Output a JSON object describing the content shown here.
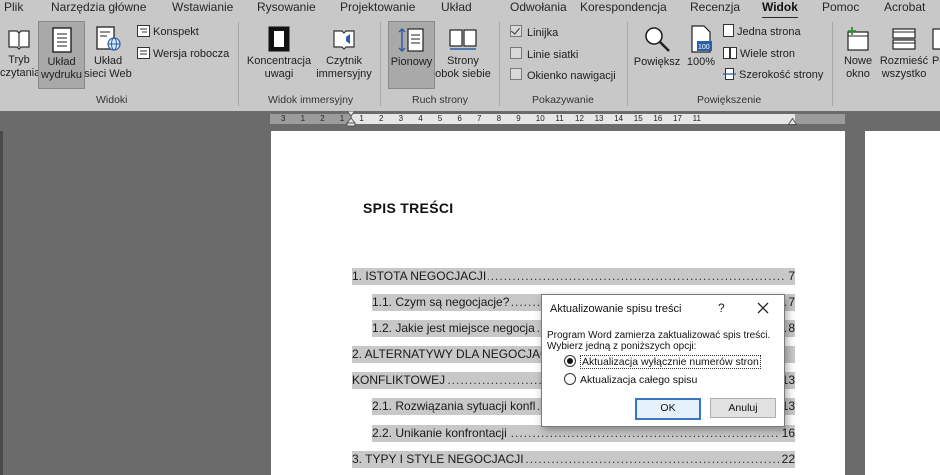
{
  "ribbon_tabs": [
    "Plik",
    "Narzędzia główne",
    "Wstawianie",
    "Rysowanie",
    "Projektowanie",
    "Układ",
    "Odwołania",
    "Korespondencja",
    "Recenzja",
    "Widok",
    "Pomoc",
    "Acrobat"
  ],
  "active_tab": "Widok",
  "groups": {
    "widoki": {
      "label": "Widoki",
      "tryb_czytania": [
        "Tryb",
        "czytania"
      ],
      "uklad_wydruku": [
        "Układ",
        "wydruku"
      ],
      "uklad_sieci_web": [
        "Układ",
        "sieci Web"
      ],
      "konspekt": "Konspekt",
      "wersja_robocza": "Wersja robocza"
    },
    "widok_immersyjny": {
      "label": "Widok immersyjny",
      "koncentracja": [
        "Koncentracja",
        "uwagi"
      ],
      "czytnik": [
        "Czytnik",
        "immersyjny"
      ]
    },
    "ruch_strony": {
      "label": "Ruch strony",
      "pionowy": "Pionowy",
      "strony_obok": [
        "Strony",
        "obok siebie"
      ]
    },
    "pokazywanie": {
      "label": "Pokazywanie",
      "linijka": "Linijka",
      "linijka_checked": true,
      "linie_siatki": "Linie siatki",
      "linie_siatki_checked": false,
      "okienko": "Okienko nawigacji",
      "okienko_checked": false
    },
    "powiekszenie": {
      "label": "Powiększenie",
      "powieksz": "Powiększ",
      "procent": "100%",
      "jedna_strona": "Jedna strona",
      "wiele_stron": "Wiele stron",
      "szerokosc": "Szerokość strony"
    },
    "okno": {
      "nowe_okno": [
        "Nowe",
        "okno"
      ],
      "rozmiesc": [
        "Rozmieść",
        "wszystko"
      ],
      "p_cut": "Po"
    }
  },
  "ruler_numbers": [
    "3",
    "1",
    "2",
    "1",
    "1",
    "2",
    "3",
    "4",
    "5",
    "6",
    "7",
    "8",
    "9",
    "10",
    "11",
    "12",
    "13",
    "14",
    "15",
    "16",
    "17",
    "11"
  ],
  "document": {
    "toc_title": "SPIS TREŚCI",
    "entries": [
      {
        "text": "1. ISTOTA NEGOCJACJI",
        "page": "7"
      },
      {
        "text": "1.1. Czym są negocjacje?",
        "page": "7"
      },
      {
        "text": "1.2. Jakie jest miejsce negocja",
        "page": "8"
      },
      {
        "text": "2. ALTERNATYWY DLA NEGOCJAC",
        "page": ""
      },
      {
        "text": "KONFLIKTOWEJ",
        "page": "13"
      },
      {
        "text": "2.1. Rozwiązania sytuacji konfl",
        "page": "13"
      },
      {
        "text": "2.2. Unikanie konfrontacji",
        "page": "16"
      },
      {
        "text": "3. TYPY I STYLE NEGOCJACJI",
        "page": "22"
      }
    ]
  },
  "dialog": {
    "title": "Aktualizowanie spisu treści",
    "help": "?",
    "message_line1": "Program Word zamierza zaktualizować spis treści.",
    "message_line2": "Wybierz jedną z poniższych opcji:",
    "option1": "Aktualizacja wyłącznie numerów stron",
    "option2": "Aktualizacja całego spisu",
    "selected_option": 1,
    "ok": "OK",
    "cancel": "Anuluj"
  }
}
